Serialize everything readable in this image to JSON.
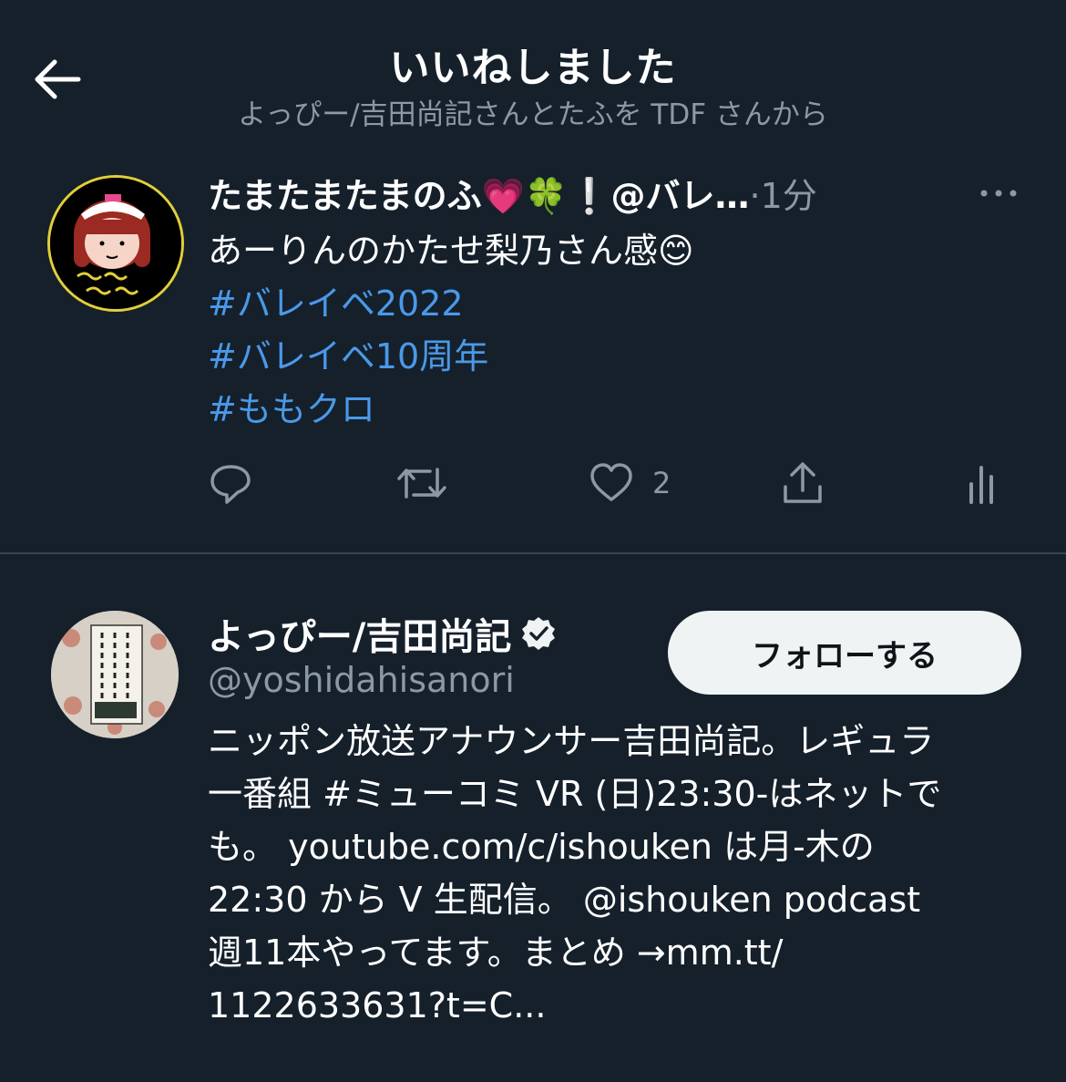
{
  "header": {
    "back_icon": "arrow-left-icon",
    "title": "いいねしました",
    "subtitle": "よっぴー/吉田尚記さんとたふを TDF さんから"
  },
  "tweet": {
    "avatar_icon": "profile-avatar",
    "name": "たまたまたまのふ💗🍀❕@バレ…",
    "separator": "·",
    "time": "1分",
    "more_icon": "more-dots-icon",
    "text_lines": [
      "あーりんのかたせ梨乃さん感😊"
    ],
    "hashtags": [
      "#バレイベ2022",
      "#バレイベ10周年",
      "#ももクロ"
    ],
    "actions": {
      "reply_icon": "reply-icon",
      "retweet_icon": "retweet-icon",
      "like_icon": "heart-icon",
      "like_count": "2",
      "share_icon": "share-icon",
      "analytics_icon": "analytics-icon"
    }
  },
  "user": {
    "name": "よっぴー/吉田尚記",
    "verified_icon": "verified-badge-icon",
    "handle": "@yoshidahisanori",
    "follow_label": "フォローする",
    "bio_lines": [
      "ニッポン放送アナウンサー吉田尚記。レギュラ",
      "一番組 #ミューコミ VR (日)23:30-はネットで",
      "も。 youtube.com/c/ishouken は月-木の",
      "22:30 から V 生配信。 @ishouken podcast",
      "週11本やってます。まとめ →mm.tt/",
      "1122633631?t=C..."
    ]
  },
  "colors": {
    "background": "#15202b",
    "link": "#4a99e9",
    "secondary_text": "#8b98a5",
    "divider": "#38444d",
    "follow_button": "#eff3f4"
  }
}
